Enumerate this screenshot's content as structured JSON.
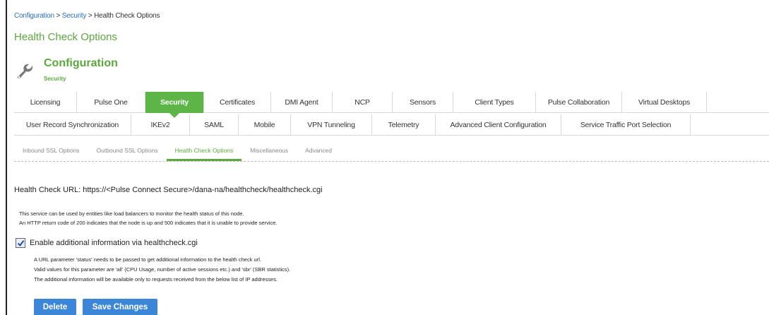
{
  "breadcrumb": {
    "items": [
      "Configuration",
      "Security",
      "Health Check Options"
    ],
    "separator": ">"
  },
  "page_title": "Health Check Options",
  "section": {
    "title": "Configuration",
    "subtitle": "Security",
    "icon": "wrench-icon"
  },
  "tabs_row1": [
    "Licensing",
    "Pulse One",
    "Security",
    "Certificates",
    "DMI Agent",
    "NCP",
    "Sensors",
    "Client Types",
    "Pulse Collaboration",
    "Virtual Desktops"
  ],
  "tabs_row2": [
    "User Record Synchronization",
    "IKEv2",
    "SAML",
    "Mobile",
    "VPN Tunneling",
    "Telemetry",
    "Advanced Client Configuration",
    "Service Traffic Port Selection"
  ],
  "active_tab": "Security",
  "subtabs": [
    "Inbound SSL Options",
    "Outbound SSL Options",
    "Health Check Options",
    "Miscellaneous",
    "Advanced"
  ],
  "active_subtab": "Health Check Options",
  "health_check": {
    "label": "Health Check URL:",
    "url": "https://<Pulse Connect Secure>/dana-na/healthcheck/healthcheck.cgi",
    "desc1": "This service can be used by entities like load balancers to monitor the health status of this node.",
    "desc2": "An HTTP return code of 200 indicates that the node is up and 500 indicates that it is unable to provide service."
  },
  "enable_option": {
    "checked": true,
    "label": "Enable additional information via healthcheck.cgi",
    "desc1": "A URL parameter 'status' needs to be passed to get additional information to the health check url.",
    "desc2": "Valid values for this parameter are 'all' (CPU Usage, number of active sessions etc.) and 'sbr' (SBR statistics).",
    "desc3": "The additional information will be available only to requests received from the below list of IP addresses."
  },
  "buttons": {
    "delete": "Delete",
    "save": "Save Changes"
  },
  "colors": {
    "accent_green": "#5db548",
    "title_green": "#5aa83e",
    "button_blue": "#3b86d6",
    "link_blue": "#2a6fb8"
  }
}
